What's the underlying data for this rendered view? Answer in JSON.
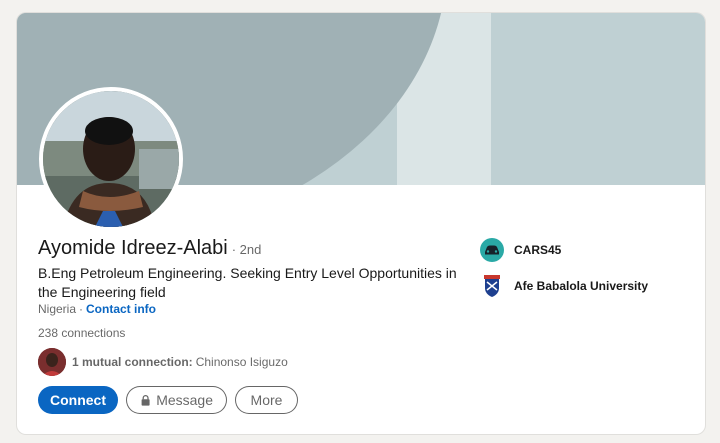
{
  "profile": {
    "name": "Ayomide Idreez-Alabi",
    "degree": "· 2nd",
    "headline": "B.Eng Petroleum Engineering. Seeking Entry Level Opportunities in the Engineering field",
    "location": "Nigeria",
    "location_separator": "·",
    "contact_label": "Contact info",
    "connections": "238 connections",
    "mutual_prefix": "1 mutual connection:",
    "mutual_name": "Chinonso Isiguzo",
    "avatar_icon": "profile-photo",
    "mutual_avatar_icon": "mutual-connection-photo"
  },
  "actions": {
    "connect_label": "Connect",
    "message_label": "Message",
    "message_icon": "lock-icon",
    "more_label": "More"
  },
  "orgs": [
    {
      "name": "CARS45",
      "logo_icon": "cars45-logo"
    },
    {
      "name": "Afe Babalola University",
      "logo_icon": "university-crest-logo"
    }
  ],
  "colors": {
    "primary": "#0a66c2",
    "banner_light": "#bfd0d3",
    "banner_circle": "#a0b1b5",
    "cars45_teal": "#2aa9a6"
  }
}
